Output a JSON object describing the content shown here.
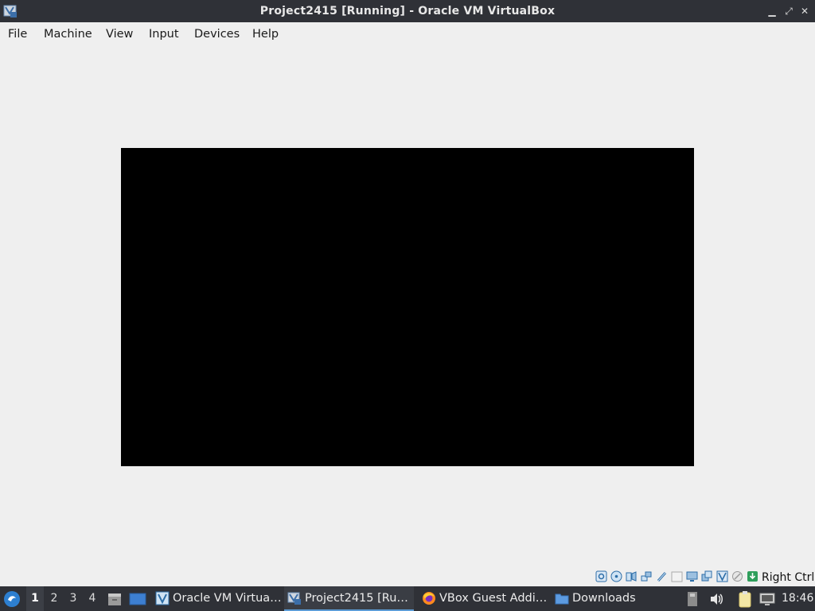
{
  "window": {
    "title": "Project2415 [Running] - Oracle VM VirtualBox",
    "minimize_glyph": "▁",
    "maximize_glyph": "⤢",
    "close_glyph": "✕"
  },
  "menubar": {
    "items": [
      {
        "label": "File"
      },
      {
        "label": "Machine"
      },
      {
        "label": "View"
      },
      {
        "label": "Input"
      },
      {
        "label": "Devices"
      },
      {
        "label": "Help"
      }
    ]
  },
  "statusbar": {
    "icons": [
      "hard-disk-icon",
      "optical-disk-icon",
      "audio-icon",
      "network-icon",
      "usb-icon",
      "shared-folders-icon",
      "display-icon",
      "video-capture-icon",
      "virtualization-icon",
      "mouse-integration-icon",
      "keyboard-capture-icon"
    ],
    "host_key": "Right Ctrl"
  },
  "taskbar": {
    "desktops": [
      "1",
      "2",
      "3",
      "4"
    ],
    "active_desktop": "1",
    "tasks": [
      {
        "label": "Oracle VM Virtua…",
        "icon": "virtualbox-manager-icon"
      },
      {
        "label": "Project2415 [Ru…",
        "icon": "virtualbox-vm-icon"
      },
      {
        "label": "VBox Guest Addi…",
        "icon": "firefox-icon"
      },
      {
        "label": "Downloads",
        "icon": "folder-icon"
      }
    ],
    "clock": "18:46"
  },
  "colors": {
    "titlebar": "#2f3137",
    "taskbar": "#2f3137",
    "background": "#efefef",
    "vm_screen": "#000000",
    "accent": "#5b9bd5"
  }
}
